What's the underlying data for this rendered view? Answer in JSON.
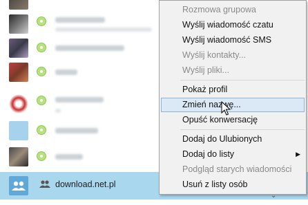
{
  "contact_list": {
    "selected_contact": {
      "name": "download.net.pl",
      "icon": "group-icon"
    },
    "expand_arrow": "⌄"
  },
  "context_menu": {
    "items": [
      {
        "label": "Rozmowa grupowa",
        "enabled": false
      },
      {
        "label": "Wyślij wiadomość czatu",
        "enabled": true
      },
      {
        "label": "Wyślij wiadomość SMS",
        "enabled": true
      },
      {
        "label": "Wyślij kontakty...",
        "enabled": false
      },
      {
        "label": "Wyślij pliki...",
        "enabled": false
      },
      {
        "label": "Pokaż profil",
        "enabled": true
      },
      {
        "label": "Zmień nazwę...",
        "enabled": true,
        "highlighted": true
      },
      {
        "label": "Opuść konwersację",
        "enabled": true
      },
      {
        "label": "Dodaj do Ulubionych",
        "enabled": true
      },
      {
        "label": "Dodaj do listy",
        "enabled": true,
        "submenu_arrow": "▶"
      },
      {
        "label": "Podgląd starych wiadomości",
        "enabled": false
      },
      {
        "label": "Usuń z listy osób",
        "enabled": true
      }
    ]
  },
  "colors": {
    "selection": "#a9d7ee",
    "menu_background": "#f1f1f1",
    "menu_highlight": "#dbe9f6",
    "status_online": "#b7e27f"
  }
}
